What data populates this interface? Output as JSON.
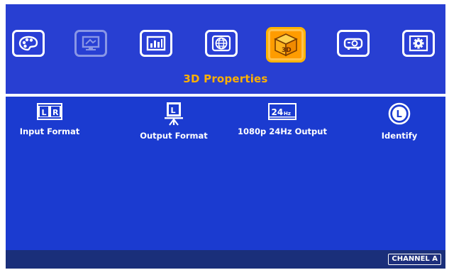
{
  "menu": {
    "tabs": [
      {
        "icon": "palette-icon"
      },
      {
        "icon": "display-icon"
      },
      {
        "icon": "adjustment-bars-icon"
      },
      {
        "icon": "globe-icon"
      },
      {
        "icon": "3d-cube-icon",
        "label": "3D",
        "active": true
      },
      {
        "icon": "projector-icon"
      },
      {
        "icon": "gear-icon"
      }
    ],
    "active_title": "3D Properties"
  },
  "options": [
    {
      "label": "Input Format",
      "icon": "lr-format-icon",
      "icon_text": "L R"
    },
    {
      "label": "Output Format",
      "icon": "easel-l-icon",
      "icon_text": "L"
    },
    {
      "label": "1080p 24Hz Output",
      "icon": "24hz-icon",
      "icon_text": "24Hz"
    },
    {
      "label": "Identify",
      "icon": "identify-l-icon",
      "icon_text": "L"
    }
  ],
  "status": {
    "channel": "CHANNEL A"
  },
  "colors": {
    "top_panel": "#283fd2",
    "content_panel": "#1b3bd0",
    "status_bar": "#1a2f7a",
    "active_tab": "#ff9c00",
    "title_text": "#ffb000",
    "text": "#ffffff"
  }
}
